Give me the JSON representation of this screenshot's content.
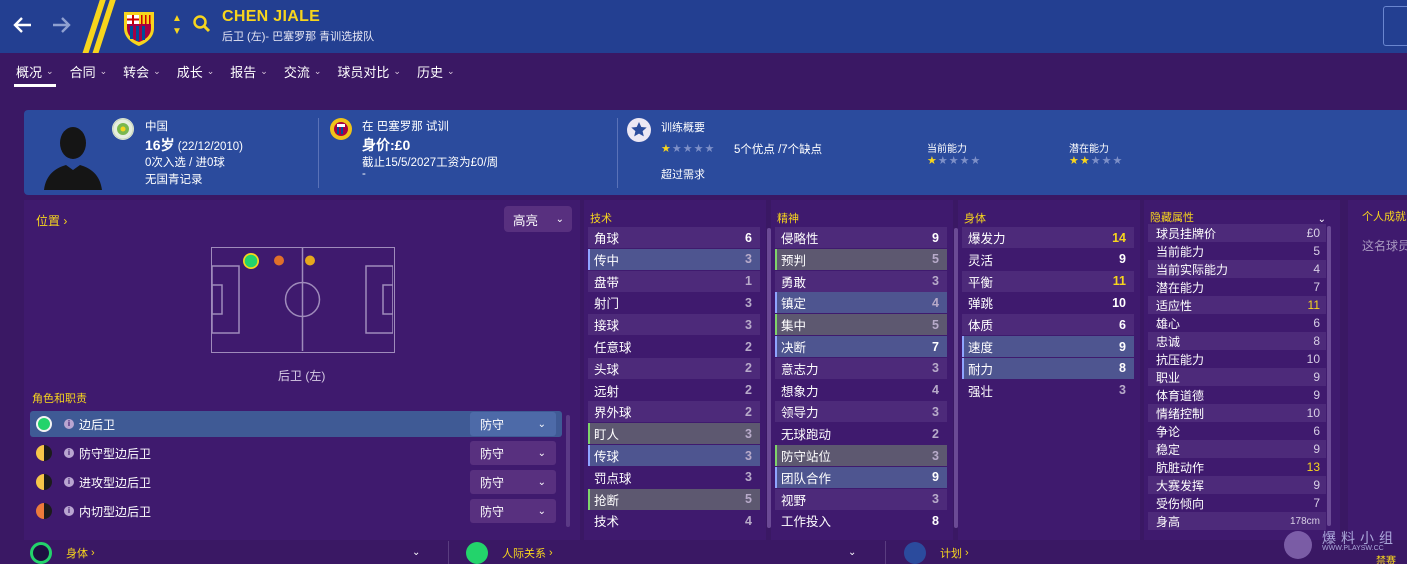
{
  "header": {
    "player_name": "CHEN JIALE",
    "subtitle": "后卫 (左)- 巴塞罗那 青训选拔队",
    "back_icon": "arrow-left",
    "forward_icon": "arrow-right",
    "accent_color": "#f7d51d",
    "bg_color": "#233f91"
  },
  "tabs": [
    {
      "label": "概况",
      "active": true
    },
    {
      "label": "合同"
    },
    {
      "label": "转会"
    },
    {
      "label": "成长"
    },
    {
      "label": "报告"
    },
    {
      "label": "交流"
    },
    {
      "label": "球员对比"
    },
    {
      "label": "历史"
    }
  ],
  "profile": {
    "nation": "中国",
    "age": "16岁",
    "dob": "(22/12/2010)",
    "caps": "0次入选 / 进0球",
    "youth_record": "无国青记录",
    "club_line": "在 巴塞罗那 试训",
    "value_label": "身价:",
    "value": "£0",
    "contract": "截止15/5/2027工资为£0/周",
    "contract_extra": "-",
    "training_title": "训练概要",
    "strengths": "5个优点 /7个缺点",
    "training_note": "超过需求",
    "current_ability_label": "当前能力",
    "potential_ability_label": "潜在能力",
    "training_stars": 0.5,
    "current_ability_stars": 0.5,
    "potential_ability_stars": 1.5
  },
  "position": {
    "label": "位置",
    "highlight_label": "高亮",
    "position_label": "后卫 (左)",
    "roles_heading": "角色和职责",
    "roles": [
      {
        "name": "边后卫",
        "duty": "防守",
        "dot": "#23d36b",
        "selected": true
      },
      {
        "name": "防守型边后卫",
        "duty": "防守",
        "dot": "half-yellow"
      },
      {
        "name": "进攻型边后卫",
        "duty": "防守",
        "dot": "half-yellow"
      },
      {
        "name": "内切型边后卫",
        "duty": "防守",
        "dot": "half-orange"
      }
    ]
  },
  "technical": {
    "heading": "技术",
    "rows": [
      {
        "name": "角球",
        "value": "6",
        "style": "w"
      },
      {
        "name": "传中",
        "value": "3",
        "hl": "hl"
      },
      {
        "name": "盘带",
        "value": "1"
      },
      {
        "name": "射门",
        "value": "3"
      },
      {
        "name": "接球",
        "value": "3"
      },
      {
        "name": "任意球",
        "value": "2"
      },
      {
        "name": "头球",
        "value": "2"
      },
      {
        "name": "远射",
        "value": "2"
      },
      {
        "name": "界外球",
        "value": "2"
      },
      {
        "name": "盯人",
        "value": "3",
        "hl": "hl2"
      },
      {
        "name": "传球",
        "value": "3",
        "hl": "hl"
      },
      {
        "name": "罚点球",
        "value": "3"
      },
      {
        "name": "抢断",
        "value": "5",
        "hl": "hl2"
      },
      {
        "name": "技术",
        "value": "4"
      }
    ]
  },
  "mental": {
    "heading": "精神",
    "rows": [
      {
        "name": "侵略性",
        "value": "9",
        "style": "w"
      },
      {
        "name": "预判",
        "value": "5",
        "hl": "hl2"
      },
      {
        "name": "勇敢",
        "value": "3"
      },
      {
        "name": "镇定",
        "value": "4",
        "hl": "hl"
      },
      {
        "name": "集中",
        "value": "5",
        "hl": "hl2"
      },
      {
        "name": "决断",
        "value": "7",
        "style": "w",
        "hl": "hl"
      },
      {
        "name": "意志力",
        "value": "3"
      },
      {
        "name": "想象力",
        "value": "4"
      },
      {
        "name": "领导力",
        "value": "3"
      },
      {
        "name": "无球跑动",
        "value": "2"
      },
      {
        "name": "防守站位",
        "value": "3",
        "hl": "hl2"
      },
      {
        "name": "团队合作",
        "value": "9",
        "style": "w",
        "hl": "hl"
      },
      {
        "name": "视野",
        "value": "3"
      },
      {
        "name": "工作投入",
        "value": "8",
        "style": "w"
      }
    ]
  },
  "physical": {
    "heading": "身体",
    "rows": [
      {
        "name": "爆发力",
        "value": "14",
        "style": "y"
      },
      {
        "name": "灵活",
        "value": "9",
        "style": "w"
      },
      {
        "name": "平衡",
        "value": "11",
        "style": "y"
      },
      {
        "name": "弹跳",
        "value": "10",
        "style": "w"
      },
      {
        "name": "体质",
        "value": "6",
        "style": "w"
      },
      {
        "name": "速度",
        "value": "9",
        "style": "w",
        "hl": "hl"
      },
      {
        "name": "耐力",
        "value": "8",
        "style": "w",
        "hl": "hl"
      },
      {
        "name": "强壮",
        "value": "3"
      }
    ]
  },
  "hidden": {
    "heading": "隐藏属性",
    "rows": [
      {
        "name": "球员挂牌价",
        "value": "£0"
      },
      {
        "name": "当前能力",
        "value": "5"
      },
      {
        "name": "当前实际能力",
        "value": "4"
      },
      {
        "name": "潜在能力",
        "value": "7"
      },
      {
        "name": "适应性",
        "value": "11",
        "style": "y"
      },
      {
        "name": "雄心",
        "value": "6"
      },
      {
        "name": "忠诚",
        "value": "8"
      },
      {
        "name": "抗压能力",
        "value": "10"
      },
      {
        "name": "职业",
        "value": "9"
      },
      {
        "name": "体育道德",
        "value": "9"
      },
      {
        "name": "情绪控制",
        "value": "10"
      },
      {
        "name": "争论",
        "value": "6"
      },
      {
        "name": "稳定",
        "value": "9"
      },
      {
        "name": "肮脏动作",
        "value": "13",
        "style": "y"
      },
      {
        "name": "大赛发挥",
        "value": "9"
      },
      {
        "name": "受伤倾向",
        "value": "7"
      },
      {
        "name": "身高",
        "value": "178cm",
        "style": "sm"
      }
    ]
  },
  "right_stub": {
    "title": "个人成就",
    "text": "这名球员"
  },
  "bottom": {
    "physical_label": "身体",
    "relations_label": "人际关系",
    "plan_label": "计划",
    "watermark_text": "爆料小组",
    "watermark_url": "WWW.PLAYSW.CC",
    "corner_label": "禁赛"
  }
}
